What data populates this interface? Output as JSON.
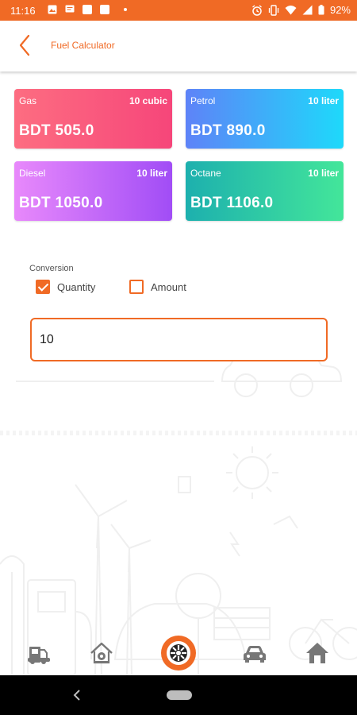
{
  "status_bar": {
    "time": "11:16",
    "battery": "92%",
    "left_icons": [
      "image-icon",
      "message-icon",
      "square-icon",
      "square-icon",
      "dot-icon"
    ],
    "right_icons": [
      "alarm-icon",
      "vibrate-icon",
      "wifi-icon",
      "signal-icon",
      "battery-icon"
    ]
  },
  "header": {
    "title": "Fuel Calculator",
    "back_icon": "chevron-left-icon"
  },
  "cards": [
    {
      "fuel": "Gas",
      "unit": "10 cubic",
      "price": "BDT 505.0"
    },
    {
      "fuel": "Petrol",
      "unit": "10 liter",
      "price": "BDT 890.0"
    },
    {
      "fuel": "Diesel",
      "unit": "10 liter",
      "price": "BDT 1050.0"
    },
    {
      "fuel": "Octane",
      "unit": "10 liter",
      "price": "BDT 1106.0"
    }
  ],
  "conversion": {
    "label": "Conversion",
    "options": [
      {
        "label": "Quantity",
        "checked": true
      },
      {
        "label": "Amount",
        "checked": false
      }
    ],
    "input_value": "10"
  },
  "bottom_nav": {
    "items": [
      "fuel-station-icon",
      "home-repair-icon",
      "wheel-icon",
      "car-icon",
      "home-icon"
    ],
    "active": "wheel-icon"
  },
  "colors": {
    "accent": "#f06a25",
    "gas": "#f6467a",
    "petrol": "#1ed9fa",
    "diesel": "#a14df6",
    "octane": "#43e69a"
  }
}
